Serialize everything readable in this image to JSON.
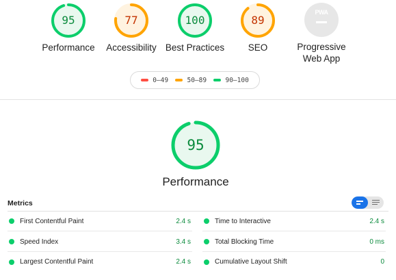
{
  "categories": [
    {
      "label": "Performance",
      "score": "95",
      "score_value": 95,
      "color": "#0cce6b",
      "text_color": "#0a8a3c",
      "track_color": "#e9f8ef"
    },
    {
      "label": "Accessibility",
      "score": "77",
      "score_value": 77,
      "color": "#ffa400",
      "text_color": "#c33300",
      "track_color": "#fff3e0"
    },
    {
      "label": "Best Practices",
      "score": "100",
      "score_value": 100,
      "color": "#0cce6b",
      "text_color": "#0a8a3c",
      "track_color": "#e9f8ef"
    },
    {
      "label": "SEO",
      "score": "89",
      "score_value": 89,
      "color": "#ffa400",
      "text_color": "#c33300",
      "track_color": "#fff3e0"
    }
  ],
  "pwa": {
    "label": "Progressive Web App",
    "badge_text": "PWA",
    "icon": "pwa-badge-icon"
  },
  "legend": [
    {
      "range": "0–49",
      "color": "#ff4e42"
    },
    {
      "range": "50–89",
      "color": "#ffa400"
    },
    {
      "range": "90–100",
      "color": "#0cce6b"
    }
  ],
  "main_gauge": {
    "score": "95",
    "score_value": 95,
    "label": "Performance",
    "color": "#0cce6b"
  },
  "metrics": {
    "title": "Metrics",
    "toggle": {
      "active": "compact-view-icon",
      "inactive": "expanded-view-icon"
    },
    "left": [
      {
        "name": "First Contentful Paint",
        "value": "2.4 s"
      },
      {
        "name": "Speed Index",
        "value": "3.4 s"
      },
      {
        "name": "Largest Contentful Paint",
        "value": "2.4 s"
      }
    ],
    "right": [
      {
        "name": "Time to Interactive",
        "value": "2.4 s"
      },
      {
        "name": "Total Blocking Time",
        "value": "0 ms"
      },
      {
        "name": "Cumulative Layout Shift",
        "value": "0"
      }
    ],
    "status_color": "#0cce6b",
    "value_color": "#0a8a3c"
  }
}
